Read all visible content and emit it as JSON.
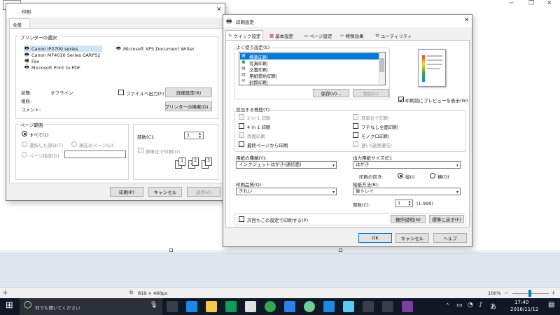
{
  "paint": {
    "status_dims": "819 × 460px",
    "zoom": "100%"
  },
  "print_dialog": {
    "title": "印刷",
    "tab_general": "全般",
    "printer_group": "プリンターの選択",
    "printers": [
      "Canon iP2700 series",
      "Canon MF4010 Series CARPS2",
      "Fax",
      "Microsoft Print to PDF",
      "Microsoft XPS Document Writer"
    ],
    "status_label": "状態:",
    "status_value": "オフライン",
    "location_label": "場所:",
    "comment_label": "コメント:",
    "print_to_file": "ファイルへ出力(F)",
    "prefs_button": "詳細設定(R)",
    "find_printer": "プリンターの検索(D)...",
    "range_group": "ページ範囲",
    "range_all": "すべて(L)",
    "range_selection": "選択した部分(T)",
    "range_current": "現在のページ(U)",
    "range_pages": "ページ指定(G):",
    "copies_label": "部数(C):",
    "copies_value": "1",
    "collate": "部単位で印刷(O)",
    "ok": "印刷(P)",
    "cancel": "キャンセル",
    "apply": "適用(A)"
  },
  "settings_dialog": {
    "title": "印刷設定",
    "tabs": [
      "クイック設定",
      "基本設定",
      "ページ設定",
      "特殊効果",
      "ユーティリティ"
    ],
    "presets_label": "よく使う設定(S)",
    "presets": [
      "標準印刷",
      "写真印刷",
      "文書印刷",
      "用紙節約印刷",
      "封筒印刷"
    ],
    "save_button": "保存(V)...",
    "delete_button": "削除(L)",
    "preview_check": "印刷前にプレビューを表示(W)",
    "features_label": "追加する機能(T)",
    "features_left": [
      "2 in 1 印刷",
      "4 in 1 印刷",
      "両面印刷",
      "最終ページから印刷"
    ],
    "features_right": [
      "部単位で印刷",
      "フチなし全面印刷",
      "モノクロ印刷",
      "速い(速度優先)"
    ],
    "media_label": "用紙の種類(Y):",
    "media_value": "インクジェットはがき(通信面)",
    "size_label": "出力用紙サイズ(E):",
    "size_value": "はがき",
    "orientation_label": "印刷の向き:",
    "orient_portrait": "縦(I)",
    "orient_landscape": "横(D)",
    "quality_label": "印刷品質(Q):",
    "quality_value": "きれい",
    "feed_label": "給紙方法(R):",
    "feed_value": "後トレイ",
    "copies_label": "部数(C):",
    "copies_value": "1",
    "copies_range": "(1-999)",
    "always_check": "次回もこの設定で印刷する(P)",
    "manual_button": "操作説明(N)",
    "defaults_button": "標準に戻す(F)",
    "ok": "OK",
    "cancel": "キャンセル",
    "help": "ヘルプ"
  },
  "taskbar": {
    "search_placeholder": "何でも聞いてください",
    "time": "17:40",
    "date": "2016/11/12",
    "ime": "あ"
  }
}
